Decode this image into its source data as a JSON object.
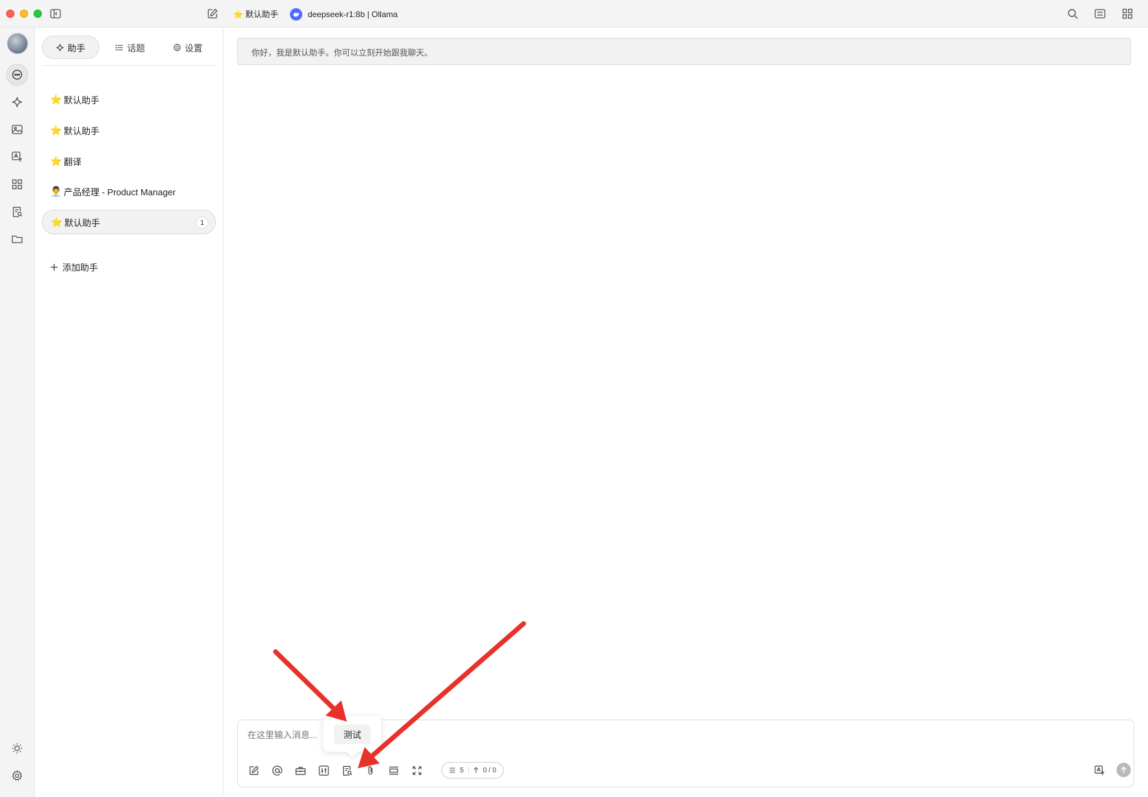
{
  "titlebar": {
    "assistant_emoji": "⭐️",
    "assistant_name": "默认助手",
    "model": "deepseek-r1:8b | Ollama"
  },
  "sidebar": {
    "tabs": [
      {
        "label": "助手",
        "icon": "sparkle-icon"
      },
      {
        "label": "话题",
        "icon": "list-icon"
      },
      {
        "label": "设置",
        "icon": "gear-icon"
      }
    ],
    "assistants": [
      {
        "emoji": "⭐️",
        "name": "默认助手"
      },
      {
        "emoji": "⭐️",
        "name": "默认助手"
      },
      {
        "emoji": "⭐️",
        "name": "翻译"
      },
      {
        "emoji": "👨‍💼",
        "name": "产品经理 - Product Manager"
      },
      {
        "emoji": "⭐️",
        "name": "默认助手",
        "badge": "1"
      }
    ],
    "add_label": "添加助手"
  },
  "chat": {
    "greeting": "你好，我是默认助手。你可以立刻开始跟我聊天。",
    "input_placeholder": "在这里输入消息...",
    "tooltip": "测试",
    "context_count": "5",
    "token_count": "0 / 0"
  },
  "colors": {
    "arrow": "#e8312b",
    "active_bg": "#f2f2f3",
    "traffic_red": "#ff5f57",
    "traffic_yellow": "#febc2e",
    "traffic_green": "#28c840"
  }
}
